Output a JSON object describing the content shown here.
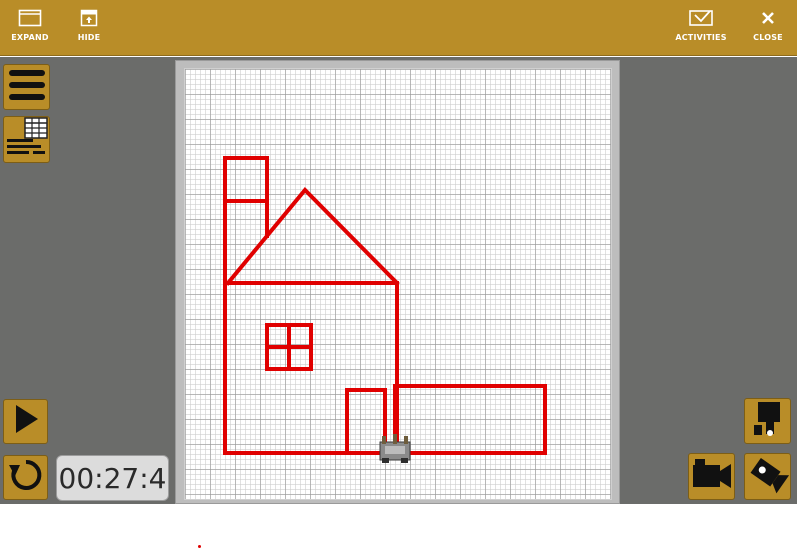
{
  "toolbar": {
    "expand_label": "EXPAND",
    "hide_label": "HIDE",
    "activities_label": "ACTIVITIES",
    "close_label": "CLOSE"
  },
  "timer": {
    "value": "00:27:4"
  },
  "colors": {
    "accent": "#b98d28",
    "workspace": "#6b6c6a",
    "drawing_stroke": "#e00000"
  },
  "icons": {
    "expand": "expand-window-icon",
    "hide": "hide-panel-icon",
    "activities": "activities-checkbox-icon",
    "close": "close-x-icon",
    "menu": "hamburger-menu-icon",
    "grid_list": "grid-list-icon",
    "play": "play-icon",
    "reset": "reset-rotate-icon",
    "robot_view": "robot-view-icon",
    "camera": "video-camera-icon",
    "camera_angle": "camera-angle-icon"
  }
}
